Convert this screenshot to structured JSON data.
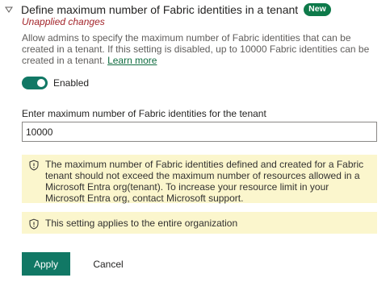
{
  "setting": {
    "title": "Define maximum number of Fabric identities in a tenant",
    "badge": "New",
    "unapplied": "Unapplied changes",
    "description": "Allow admins to specify the maximum number of Fabric identities that can be created in a tenant. If this setting is disabled, up to 10000 Fabric identities can be created in a tenant.",
    "learn_more": "Learn more"
  },
  "toggle": {
    "label": "Enabled",
    "state": "on"
  },
  "input": {
    "label": "Enter maximum number of Fabric identities for the tenant",
    "value": "10000"
  },
  "warnings": [
    {
      "icon": "shield-warning-icon",
      "text": "The maximum number of Fabric identities defined and created for a Fabric tenant should not exceed the maximum number of resources allowed in a Microsoft Entra org(tenant). To increase your resource limit in your Microsoft Entra org, contact Microsoft support."
    },
    {
      "icon": "shield-warning-icon",
      "text": "This setting applies to the entire organization"
    }
  ],
  "buttons": {
    "apply": "Apply",
    "cancel": "Cancel"
  },
  "colors": {
    "accent": "#117865",
    "badge": "#0e7a4a",
    "unapplied": "#a4262c",
    "warning_bg": "#fbf6cd"
  }
}
